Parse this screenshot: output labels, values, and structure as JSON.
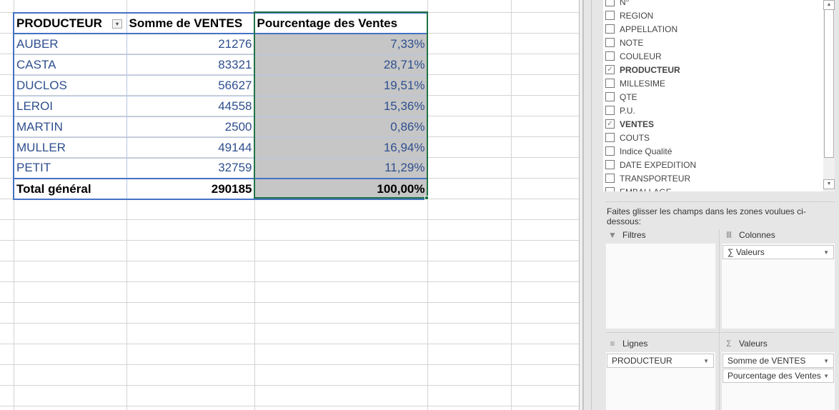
{
  "pivot": {
    "headers": [
      "PRODUCTEUR",
      "Somme de VENTES",
      "Pourcentage des Ventes"
    ],
    "rows": [
      {
        "producteur": "AUBER",
        "ventes": "21276",
        "pct": "7,33%"
      },
      {
        "producteur": "CASTA",
        "ventes": "83321",
        "pct": "28,71%"
      },
      {
        "producteur": "DUCLOS",
        "ventes": "56627",
        "pct": "19,51%"
      },
      {
        "producteur": "LEROI",
        "ventes": "44558",
        "pct": "15,36%"
      },
      {
        "producteur": "MARTIN",
        "ventes": "2500",
        "pct": "0,86%"
      },
      {
        "producteur": "MULLER",
        "ventes": "49144",
        "pct": "16,94%"
      },
      {
        "producteur": "PETIT",
        "ventes": "32759",
        "pct": "11,29%"
      }
    ],
    "total": {
      "label": "Total général",
      "ventes": "290185",
      "pct": "100,00%"
    }
  },
  "fields": [
    {
      "label": "N°",
      "checked": false
    },
    {
      "label": "REGION",
      "checked": false
    },
    {
      "label": "APPELLATION",
      "checked": false
    },
    {
      "label": "NOTE",
      "checked": false
    },
    {
      "label": "COULEUR",
      "checked": false
    },
    {
      "label": "PRODUCTEUR",
      "checked": true
    },
    {
      "label": "MILLESIME",
      "checked": false
    },
    {
      "label": "QTE",
      "checked": false
    },
    {
      "label": "P.U.",
      "checked": false
    },
    {
      "label": "VENTES",
      "checked": true
    },
    {
      "label": "COUTS",
      "checked": false
    },
    {
      "label": "Indice Qualité",
      "checked": false
    },
    {
      "label": "DATE EXPEDITION",
      "checked": false
    },
    {
      "label": "TRANSPORTEUR",
      "checked": false
    },
    {
      "label": "EMBALLAGE",
      "checked": false
    }
  ],
  "areas": {
    "hint": "Faites glisser les champs dans les zones voulues ci-dessous:",
    "filtres": "Filtres",
    "colonnes": "Colonnes",
    "lignes": "Lignes",
    "valeurs": "Valeurs",
    "colonnes_items": [
      "Valeurs"
    ],
    "lignes_items": [
      "PRODUCTEUR"
    ],
    "valeurs_items": [
      "Somme de VENTES",
      "Pourcentage des Ventes"
    ]
  }
}
